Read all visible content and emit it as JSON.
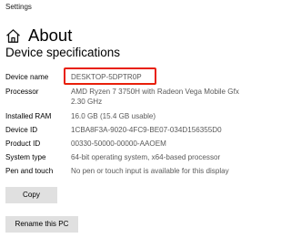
{
  "window": {
    "title": "Settings"
  },
  "header": {
    "icon": "home-icon",
    "title": "About"
  },
  "device_specifications": {
    "section_title": "Device specifications",
    "highlight_color": "#e8200a",
    "rows": [
      {
        "label": "Device name",
        "value": "DESKTOP-5DPTR0P"
      },
      {
        "label": "Processor",
        "value": "AMD Ryzen 7 3750H with Radeon Vega Mobile Gfx 2.30 GHz"
      },
      {
        "label": "Installed RAM",
        "value": "16.0 GB (15.4 GB usable)"
      },
      {
        "label": "Device ID",
        "value": "1CBA8F3A-9020-4FC9-BE07-034D156355D0"
      },
      {
        "label": "Product ID",
        "value": "00330-50000-00000-AAOEM"
      },
      {
        "label": "System type",
        "value": "64-bit operating system, x64-based processor"
      },
      {
        "label": "Pen and touch",
        "value": "No pen or touch input is available for this display"
      }
    ]
  },
  "buttons": {
    "copy": "Copy",
    "rename": "Rename this PC"
  }
}
